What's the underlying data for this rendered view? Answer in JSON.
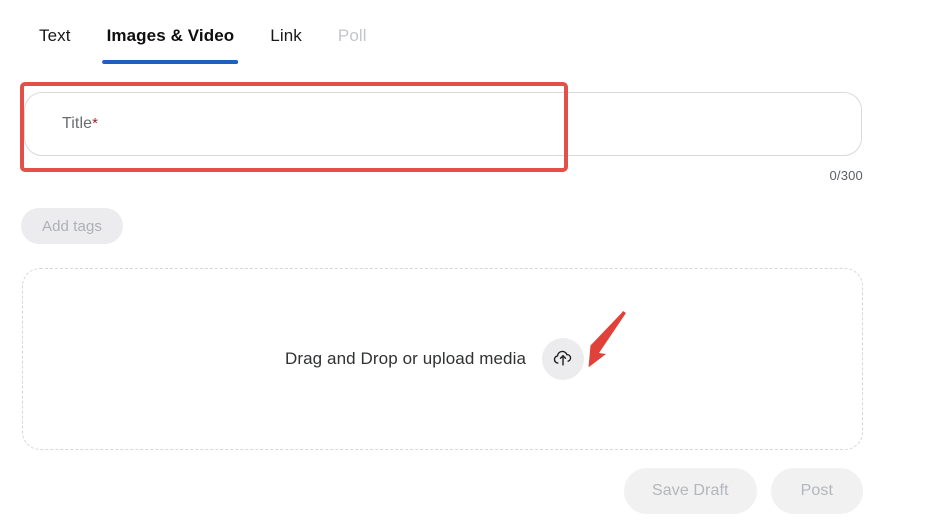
{
  "composer": {
    "tabs": [
      {
        "label": "Text",
        "state": "inactive"
      },
      {
        "label": "Images & Video",
        "state": "active"
      },
      {
        "label": "Link",
        "state": "inactive"
      },
      {
        "label": "Poll",
        "state": "disabled"
      }
    ],
    "title_field": {
      "value": "",
      "placeholder": "Title",
      "required_marker": "*",
      "char_counter": "0/300"
    },
    "tags": {
      "add_tags_label": "Add tags"
    },
    "dropzone": {
      "label": "Drag and Drop or upload media",
      "upload_icon": "cloud-upload-icon"
    },
    "footer": {
      "save_draft_label": "Save Draft",
      "post_label": "Post"
    },
    "annotations": {
      "highlight_color": "#e35048",
      "arrow_color": "#e0423a",
      "highlight_target": "title-field",
      "arrow_target": "upload-media-button"
    },
    "colors": {
      "active_tab_underline": "#1f5fbf",
      "required_asterisk": "#9b2226",
      "disabled_text": "#b3b6ba",
      "chip_background": "#ececee"
    }
  }
}
